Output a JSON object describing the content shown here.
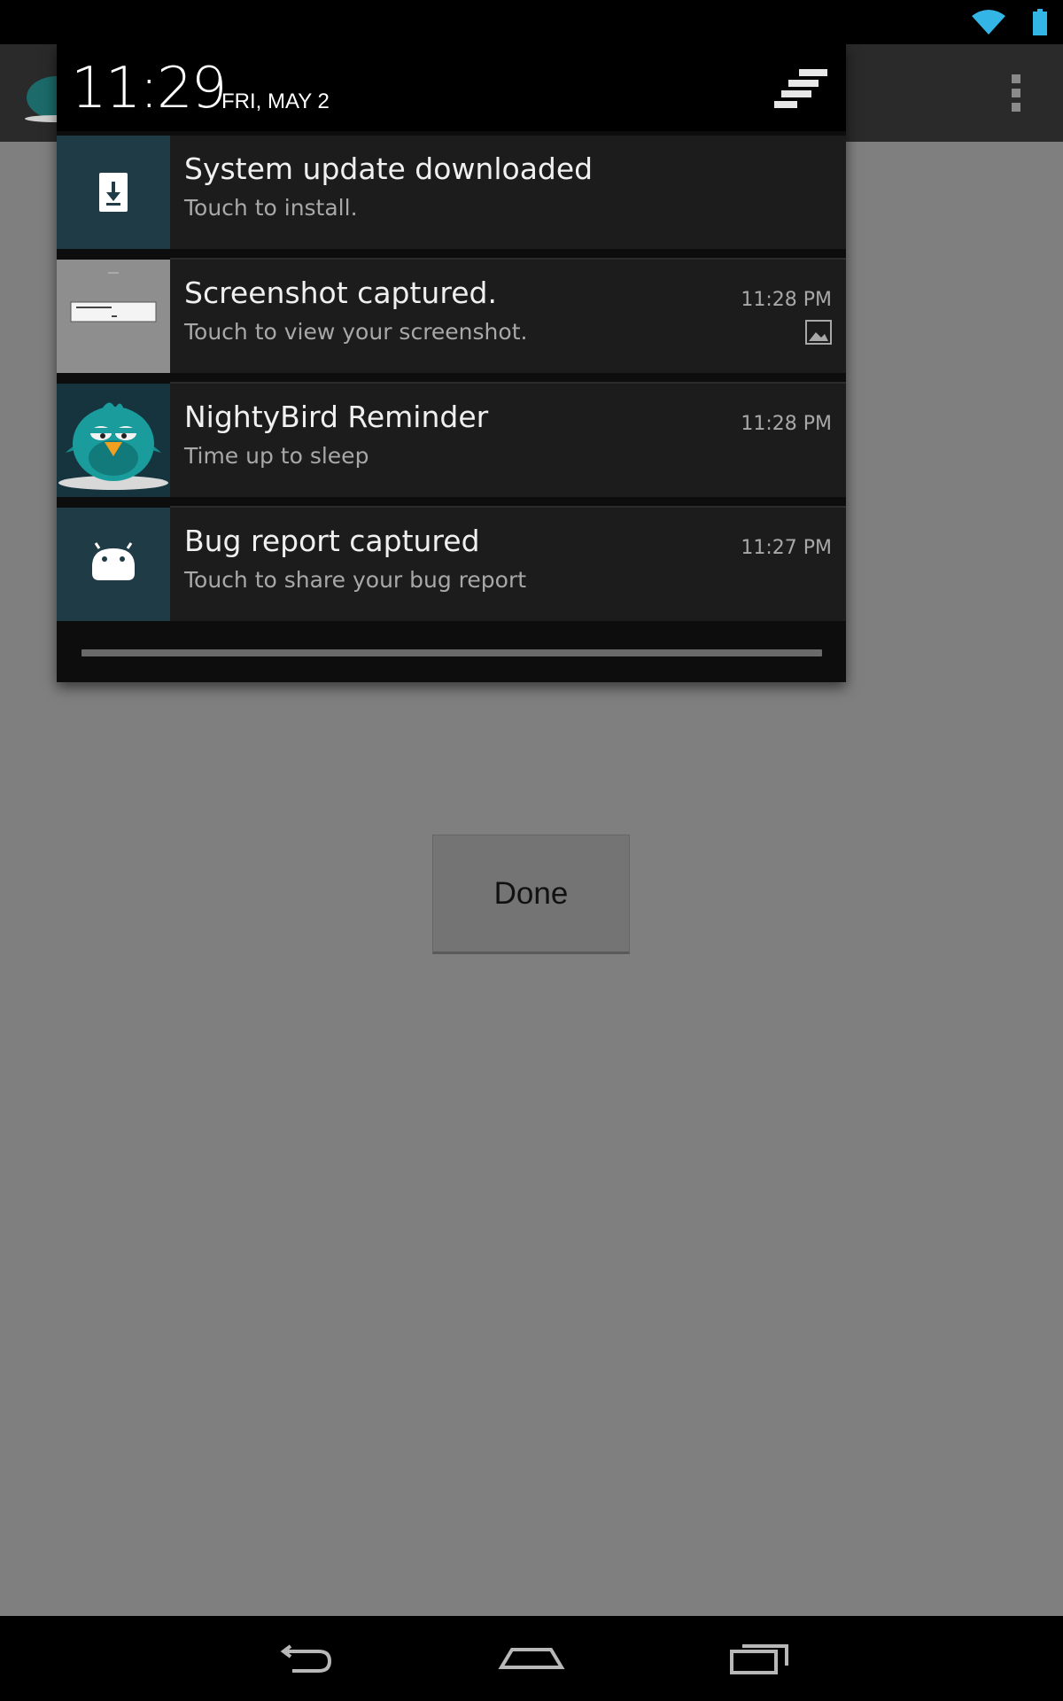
{
  "status_bar": {
    "icons": [
      "wifi-icon",
      "battery-icon"
    ],
    "accent_color": "#33b5e5"
  },
  "action_bar": {
    "icons": [
      "nightybird-app-icon",
      "overflow-menu-icon"
    ]
  },
  "shade": {
    "time": "11:29",
    "date": "FRI, MAY 2",
    "clear_icon": "clear-all-notifications-icon"
  },
  "notifications": [
    {
      "title": "System update downloaded",
      "text": "Touch to install.",
      "time": "",
      "icon": "system-update-icon"
    },
    {
      "title": "Screenshot captured.",
      "text": "Touch to view your screenshot.",
      "time": "11:28 PM",
      "icon": "screenshot-thumbnail",
      "small_icon": "picture-icon"
    },
    {
      "title": "NightyBird Reminder",
      "text": "Time up to sleep",
      "time": "11:28 PM",
      "icon": "nightybird-icon"
    },
    {
      "title": "Bug report captured",
      "text": "Touch to share your bug report",
      "time": "11:27 PM",
      "icon": "bug-report-icon"
    }
  ],
  "main": {
    "done_label": "Done"
  },
  "nav_bar": {
    "icons": [
      "back-icon",
      "home-icon",
      "recent-apps-icon"
    ]
  }
}
